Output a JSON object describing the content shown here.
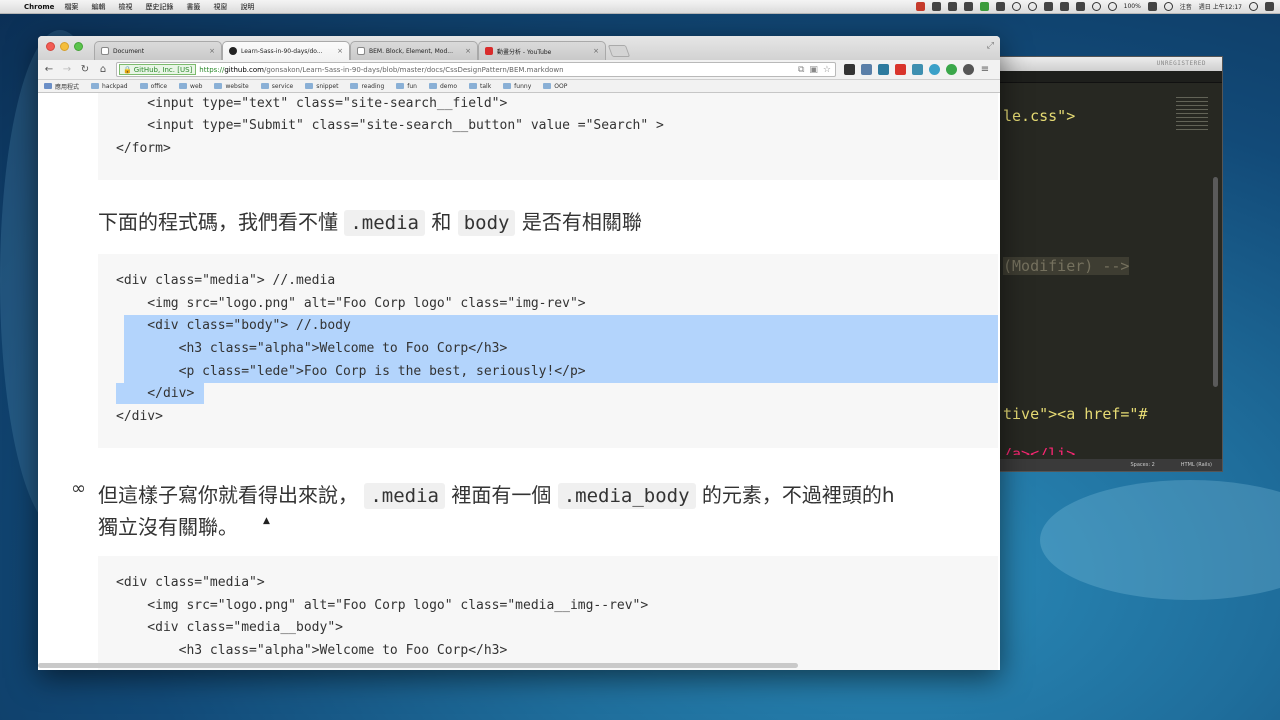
{
  "menubar": {
    "app": "Chrome",
    "menus": [
      "檔案",
      "編輯",
      "檢視",
      "歷史記錄",
      "書籤",
      "視窗",
      "說明"
    ],
    "battery": "100%",
    "input_method": "注音",
    "clock": "週日 上午12:17"
  },
  "editor": {
    "status_label": "UNREGISTERED",
    "lines": {
      "css": "le.css\">",
      "modifier": "(Modifier) -->",
      "li": "tive\"><a href=\"#",
      "close": "/a></li>"
    },
    "status_spaces": "Spaces: 2",
    "status_syntax": "HTML (Rails)"
  },
  "browser": {
    "tabs": [
      {
        "title": "Document",
        "icon": "document-icon"
      },
      {
        "title": "Learn-Sass-in-90-days/do...",
        "icon": "github-icon"
      },
      {
        "title": "BEM. Block, Element, Mod...",
        "icon": "document-icon"
      },
      {
        "title": "動畫分析 - YouTube",
        "icon": "youtube-icon"
      }
    ],
    "ev_label": "GitHub, Inc. [US]",
    "url_scheme": "https://",
    "url_host": "github.com",
    "url_path": "/gonsakon/Learn-Sass-in-90-days/blob/master/docs/CssDesignPattern/BEM.markdown",
    "bookmarks": [
      "應用程式",
      "hackpad",
      "office",
      "web",
      "website",
      "service",
      "snippet",
      "reading",
      "fun",
      "demo",
      "talk",
      "funny",
      "OOP"
    ]
  },
  "content": {
    "code1": [
      "    <input type=\"text\" class=\"site-search__field\">",
      "    <input type=\"Submit\" class=\"site-search__button\" value =\"Search\" >",
      "</form>"
    ],
    "para1_before": "下面的程式碼，我們看不懂",
    "para1_code1": ".media",
    "para1_and": "和",
    "para1_code2": "body",
    "para1_after": "是否有相關聯",
    "code2": [
      "<div class=\"media\"> //.media",
      "    <img src=\"logo.png\" alt=\"Foo Corp logo\" class=\"img-rev\">",
      "    <div class=\"body\"> //.body",
      "        <h3 class=\"alpha\">Welcome to Foo Corp</h3>",
      "        <p class=\"lede\">Foo Corp is the best, seriously!</p>",
      "    </div>",
      "</div>"
    ],
    "para2_before": "但這樣子寫你就看得出來說，",
    "para2_code1": ".media",
    "para2_mid": "裡面有一個",
    "para2_code2": ".media_body",
    "para2_after": "的元素，不過裡頭的h",
    "para2_line2": "獨立沒有關聯。",
    "code3": [
      "<div class=\"media\">",
      "    <img src=\"logo.png\" alt=\"Foo Corp logo\" class=\"media__img--rev\">",
      "    <div class=\"media__body\">",
      "        <h3 class=\"alpha\">Welcome to Foo Corp</h3>"
    ]
  }
}
